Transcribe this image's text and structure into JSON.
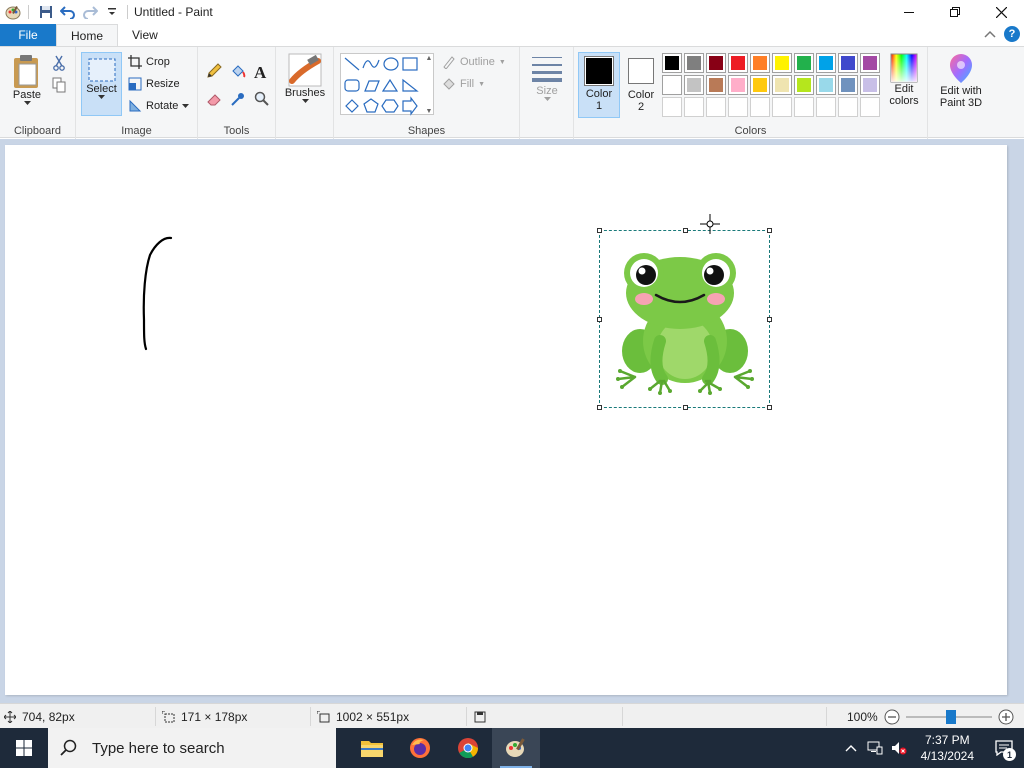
{
  "window": {
    "title": "Untitled - Paint"
  },
  "tabs": [
    {
      "label": "File"
    },
    {
      "label": "Home"
    },
    {
      "label": "View"
    }
  ],
  "ribbon": {
    "clipboard": {
      "label": "Clipboard",
      "paste": "Paste"
    },
    "image": {
      "label": "Image",
      "select": "Select",
      "crop": "Crop",
      "resize": "Resize",
      "rotate": "Rotate"
    },
    "tools": {
      "label": "Tools"
    },
    "brushes": {
      "label": "Brushes"
    },
    "shapes": {
      "label": "Shapes",
      "outline": "Outline",
      "fill": "Fill"
    },
    "size": {
      "label": "Size"
    },
    "colors": {
      "label": "Colors",
      "color1": "Color 1",
      "color1_line1": "Color",
      "color1_line2": "1",
      "color2_line1": "Color",
      "color2_line2": "2",
      "color1_value": "#000000",
      "color2_value": "#ffffff",
      "edit_colors_line1": "Edit",
      "edit_colors_line2": "colors",
      "paint3d_line1": "Edit with",
      "paint3d_line2": "Paint 3D",
      "palette_row1": [
        "#000000",
        "#7f7f7f",
        "#880015",
        "#ed1c24",
        "#ff7f27",
        "#fff200",
        "#22b14c",
        "#00a2e8",
        "#3f48cc",
        "#a349a4"
      ],
      "palette_row2": [
        "#ffffff",
        "#c3c3c3",
        "#b97a57",
        "#ffaec9",
        "#ffc90e",
        "#efe4b0",
        "#b5e61d",
        "#99d9ea",
        "#7092be",
        "#c8bfe7"
      ],
      "palette_row3": [
        "",
        "",
        "",
        "",
        "",
        "",
        "",
        "",
        "",
        ""
      ]
    }
  },
  "statusbar": {
    "cursor_pos": "704, 82px",
    "selection_size": "171 × 178px",
    "image_size": "1002 × 551px",
    "zoom": "100%"
  },
  "taskbar": {
    "search_placeholder": "Type here to search",
    "time": "7:37 PM",
    "date": "4/13/2024",
    "notification_count": "1"
  }
}
